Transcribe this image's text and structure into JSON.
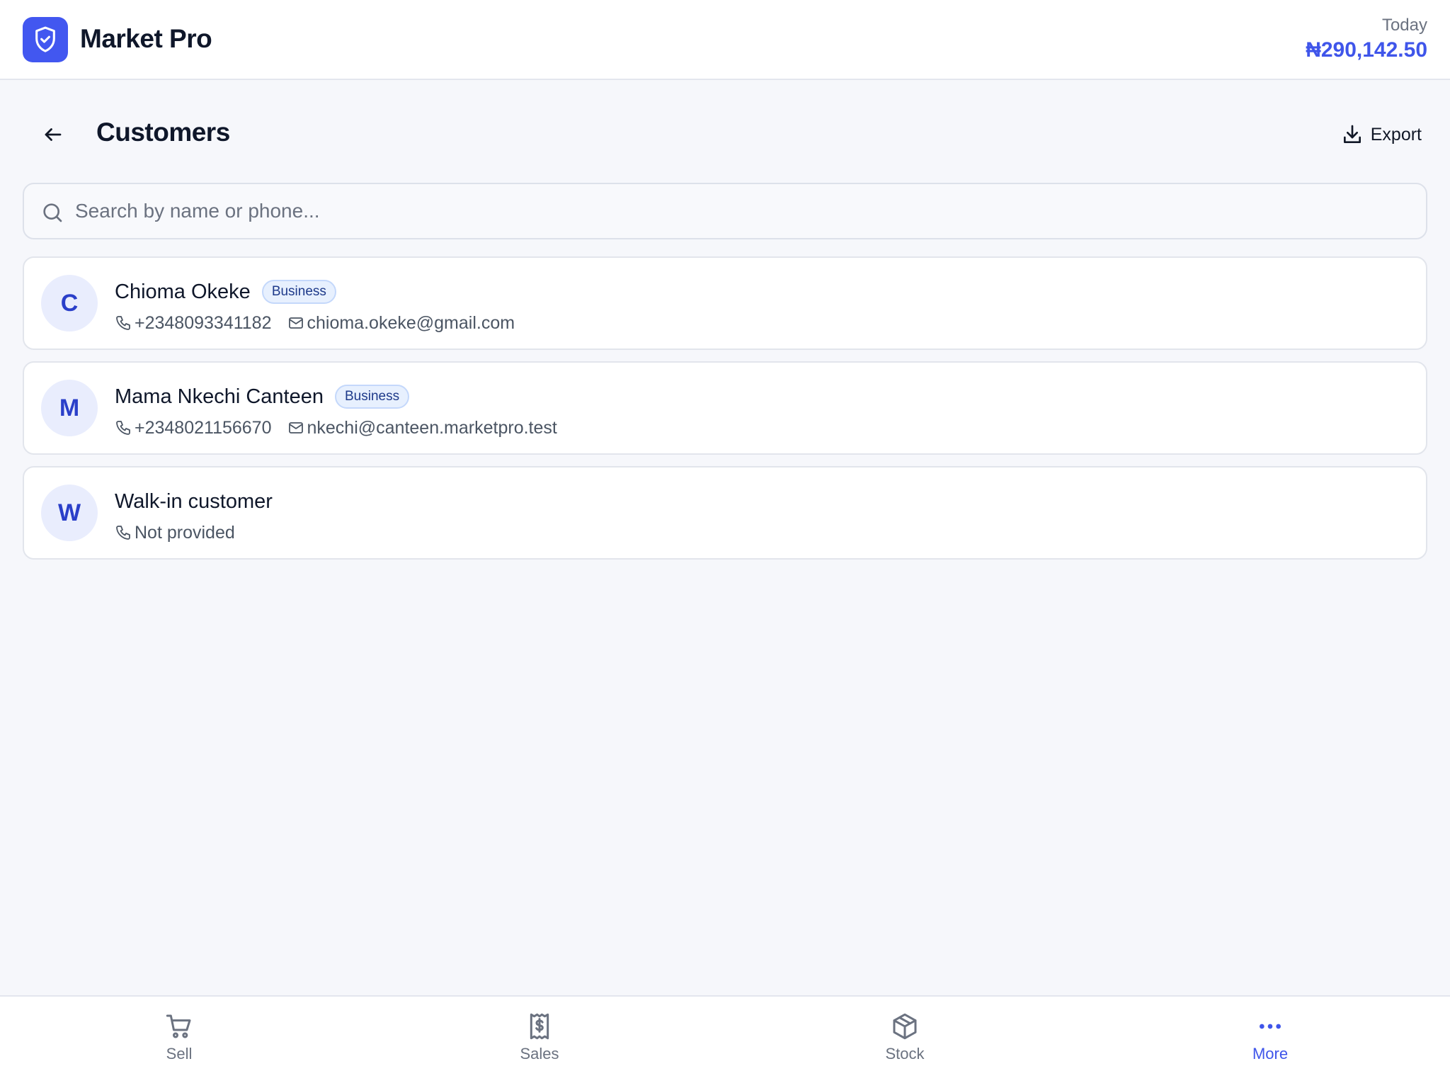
{
  "header": {
    "app_title": "Market Pro",
    "today_label": "Today",
    "today_value": "₦290,142.50",
    "logo_icon": "shield-check-icon"
  },
  "page": {
    "title": "Customers",
    "export_label": "Export"
  },
  "search": {
    "placeholder": "Search by name or phone...",
    "value": ""
  },
  "customers": [
    {
      "initial": "C",
      "name": "Chioma Okeke",
      "badge": "Business",
      "phone": "+2348093341182",
      "email": "chioma.okeke@gmail.com"
    },
    {
      "initial": "M",
      "name": "Mama Nkechi Canteen",
      "badge": "Business",
      "phone": "+2348021156670",
      "email": "nkechi@canteen.marketpro.test"
    },
    {
      "initial": "W",
      "name": "Walk-in customer",
      "badge": "",
      "phone": "Not provided",
      "email": ""
    }
  ],
  "nav": {
    "items": [
      {
        "label": "Sell",
        "icon": "cart-icon",
        "active": false
      },
      {
        "label": "Sales",
        "icon": "receipt-icon",
        "active": false
      },
      {
        "label": "Stock",
        "icon": "box-icon",
        "active": false
      },
      {
        "label": "More",
        "icon": "more-dots-icon",
        "active": true
      }
    ]
  },
  "colors": {
    "accent": "#3f55ea",
    "background": "#f6f7fb",
    "badge_bg": "#e7f0fe",
    "avatar_bg": "#e9edfd"
  }
}
